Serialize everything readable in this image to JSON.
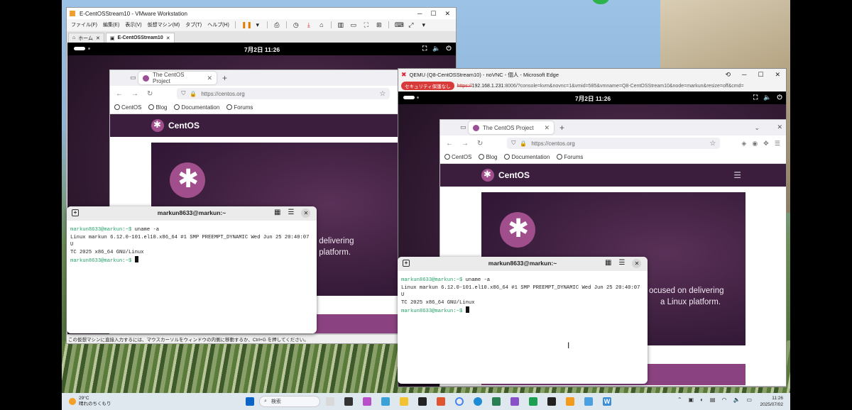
{
  "vmware": {
    "title": "E-CentOSStream10 - VMware Workstation",
    "menu": [
      "ファイル(F)",
      "編集(E)",
      "表示(V)",
      "仮想マシン(M)",
      "タブ(T)",
      "ヘルプ(H)"
    ],
    "tabs": [
      "ホーム",
      "E-CentOSStream10"
    ],
    "status": "この仮想マシンに直接入力するには、マウスカーソルをウィンドウの内側に移動するか、Ctrl+G を押してください。"
  },
  "guest": {
    "clock": "7月2日  11:26"
  },
  "browser": {
    "tab_title": "The CentOS Project",
    "url": "https://centos.org",
    "bookmarks": [
      "CentOS",
      "Blog",
      "Documentation",
      "Forums"
    ],
    "brand": "CentOS",
    "hero_line1": "ocused on delivering",
    "hero_line2": "a Linux platform."
  },
  "terminal": {
    "title": "markun8633@markun:~",
    "line1_prompt": "markun8633@markun:~$",
    "line1_cmd": " uname -a",
    "line2": "Linux markun 6.12.0-101.el10.x86_64 #1 SMP PREEMPT_DYNAMIC Wed Jun 25 20:40:07 U",
    "line3": "TC 2025 x86_64 GNU/Linux",
    "line4_prompt": "markun8633@markun:~$"
  },
  "edge": {
    "title": "QEMU (Q8-CentOSStream10) - noVNC - 個人 - Microsoft Edge",
    "security_badge": "セキュリティ保護なし",
    "url_scheme": "https://",
    "url_host": "192.168.1.231",
    "url_rest": ":8006/?console=kvm&novnc=1&vmid=585&vmname=Q8-CentOSStream10&node=markun&resize=off&cmd="
  },
  "taskbar": {
    "weather_temp": "29°C",
    "weather_desc": "晴れのちくもり",
    "search_placeholder": "検索",
    "time": "11:26",
    "date": "2025/07/02"
  },
  "colors": {
    "centos_purple": "#3b1d3e",
    "centos_logo": "#a14f8c",
    "prompt_green": "#26a269",
    "insecure_red": "#d83a3a"
  }
}
